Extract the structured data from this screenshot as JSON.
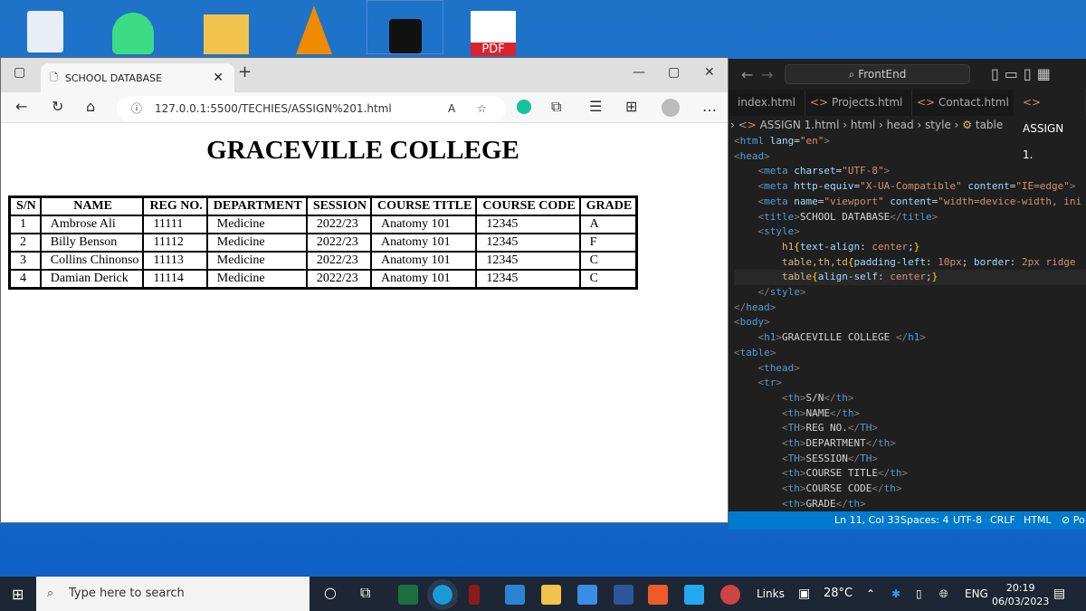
{
  "desktop": {
    "icons": [
      "recycle-bin",
      "android-studio",
      "folder",
      "vlc",
      "app",
      "pdf"
    ],
    "pdf_label": "PDF"
  },
  "browser": {
    "tab_title": "SCHOOL DATABASE",
    "url": "127.0.0.1:5500/TECHIES/ASSIGN%201.html",
    "page": {
      "heading": "GRACEVILLE COLLEGE",
      "columns": [
        "S/N",
        "NAME",
        "REG NO.",
        "DEPARTMENT",
        "SESSION",
        "COURSE TITLE",
        "COURSE CODE",
        "GRADE"
      ],
      "rows": [
        [
          "1",
          "Ambrose Ali",
          "11111",
          "Medicine",
          "2022/23",
          "Anatomy 101",
          "12345",
          "A"
        ],
        [
          "2",
          "Billy Benson",
          "11112",
          "Medicine",
          "2022/23",
          "Anatomy 101",
          "12345",
          "F"
        ],
        [
          "3",
          "Collins Chinonso",
          "11113",
          "Medicine",
          "2022/23",
          "Anatomy 101",
          "12345",
          "C"
        ],
        [
          "4",
          "Damian Derick",
          "11114",
          "Medicine",
          "2022/23",
          "Anatomy 101",
          "12345",
          "C"
        ]
      ]
    }
  },
  "editor": {
    "search": "FrontEnd",
    "tabs": [
      "index.html",
      "Projects.html",
      "Contact.html",
      "ASSIGN 1."
    ],
    "breadcrumb": [
      "ASSIGN 1.html",
      "html",
      "head",
      "style",
      "table"
    ],
    "code": [
      [
        [
          "br",
          "<"
        ],
        [
          "tag",
          "html "
        ],
        [
          "attr",
          "lang"
        ],
        [
          "txt",
          "="
        ],
        [
          "str",
          "\"en\""
        ],
        [
          "br",
          ">"
        ]
      ],
      [
        [
          "br",
          "<"
        ],
        [
          "tag",
          "head"
        ],
        [
          "br",
          ">"
        ]
      ],
      [
        [
          "txt",
          "    "
        ],
        [
          "br",
          "<"
        ],
        [
          "tag",
          "meta "
        ],
        [
          "attr",
          "charset"
        ],
        [
          "txt",
          "="
        ],
        [
          "str",
          "\"UTF-8\""
        ],
        [
          "br",
          ">"
        ]
      ],
      [
        [
          "txt",
          "    "
        ],
        [
          "br",
          "<"
        ],
        [
          "tag",
          "meta "
        ],
        [
          "attr",
          "http-equiv"
        ],
        [
          "txt",
          "="
        ],
        [
          "str",
          "\"X-UA-Compatible\" "
        ],
        [
          "attr",
          "content"
        ],
        [
          "txt",
          "="
        ],
        [
          "str",
          "\"IE=edge\""
        ],
        [
          "br",
          ">"
        ]
      ],
      [
        [
          "txt",
          "    "
        ],
        [
          "br",
          "<"
        ],
        [
          "tag",
          "meta "
        ],
        [
          "attr",
          "name"
        ],
        [
          "txt",
          "="
        ],
        [
          "str",
          "\"viewport\" "
        ],
        [
          "attr",
          "content"
        ],
        [
          "txt",
          "="
        ],
        [
          "str",
          "\"width=device-width, ini"
        ]
      ],
      [
        [
          "txt",
          "    "
        ],
        [
          "br",
          "<"
        ],
        [
          "tag",
          "title"
        ],
        [
          "br",
          ">"
        ],
        [
          "txt",
          "SCHOOL DATABASE"
        ],
        [
          "br",
          "</"
        ],
        [
          "tag",
          "title"
        ],
        [
          "br",
          ">"
        ]
      ],
      [
        [
          "txt",
          "    "
        ],
        [
          "br",
          "<"
        ],
        [
          "tag",
          "style"
        ],
        [
          "br",
          ">"
        ]
      ],
      [
        [
          "txt",
          "        "
        ],
        [
          "sel",
          "h1"
        ],
        [
          "punc",
          "{"
        ],
        [
          "attr",
          "text-align"
        ],
        [
          "txt",
          ": "
        ],
        [
          "str",
          "center"
        ],
        [
          "txt",
          ";"
        ],
        [
          "punc",
          "}"
        ]
      ],
      [
        [
          "txt",
          "        "
        ],
        [
          "sel",
          "table,th,td"
        ],
        [
          "punc",
          "{"
        ],
        [
          "attr",
          "padding-left"
        ],
        [
          "txt",
          ": "
        ],
        [
          "str",
          "10px"
        ],
        [
          "txt",
          "; "
        ],
        [
          "attr",
          "border"
        ],
        [
          "txt",
          ": "
        ],
        [
          "str",
          "2px ridge"
        ]
      ],
      [
        [
          "txt",
          "        "
        ],
        [
          "sel",
          "table"
        ],
        [
          "punc",
          "{"
        ],
        [
          "attr",
          "align-self"
        ],
        [
          "txt",
          ": "
        ],
        [
          "str",
          "center"
        ],
        [
          "txt",
          ";"
        ],
        [
          "punc",
          "}"
        ]
      ],
      [
        [
          "txt",
          "    "
        ],
        [
          "br",
          "</"
        ],
        [
          "tag",
          "style"
        ],
        [
          "br",
          ">"
        ]
      ],
      [
        [
          "br",
          "</"
        ],
        [
          "tag",
          "head"
        ],
        [
          "br",
          ">"
        ]
      ],
      [
        [
          "br",
          "<"
        ],
        [
          "tag",
          "body"
        ],
        [
          "br",
          ">"
        ]
      ],
      [
        [
          "txt",
          "    "
        ],
        [
          "br",
          "<"
        ],
        [
          "tag",
          "h1"
        ],
        [
          "br",
          ">"
        ],
        [
          "txt",
          "GRACEVILLE COLLEGE "
        ],
        [
          "br",
          "</"
        ],
        [
          "tag",
          "h1"
        ],
        [
          "br",
          ">"
        ]
      ],
      [
        [
          "br",
          "<"
        ],
        [
          "tag",
          "table"
        ],
        [
          "br",
          ">"
        ]
      ],
      [
        [
          "txt",
          "    "
        ],
        [
          "br",
          "<"
        ],
        [
          "tag",
          "thead"
        ],
        [
          "br",
          ">"
        ]
      ],
      [
        [
          "txt",
          "    "
        ],
        [
          "br",
          "<"
        ],
        [
          "tag",
          "tr"
        ],
        [
          "br",
          ">"
        ]
      ],
      [
        [
          "txt",
          "        "
        ],
        [
          "br",
          "<"
        ],
        [
          "tag",
          "th"
        ],
        [
          "br",
          ">"
        ],
        [
          "txt",
          "S/N"
        ],
        [
          "br",
          "</"
        ],
        [
          "tag",
          "th"
        ],
        [
          "br",
          ">"
        ]
      ],
      [
        [
          "txt",
          "        "
        ],
        [
          "br",
          "<"
        ],
        [
          "tag",
          "th"
        ],
        [
          "br",
          ">"
        ],
        [
          "txt",
          "NAME"
        ],
        [
          "br",
          "</"
        ],
        [
          "tag",
          "th"
        ],
        [
          "br",
          ">"
        ]
      ],
      [
        [
          "txt",
          "        "
        ],
        [
          "br",
          "<"
        ],
        [
          "tag",
          "TH"
        ],
        [
          "br",
          ">"
        ],
        [
          "txt",
          "REG NO."
        ],
        [
          "br",
          "</"
        ],
        [
          "tag",
          "TH"
        ],
        [
          "br",
          ">"
        ]
      ],
      [
        [
          "txt",
          "        "
        ],
        [
          "br",
          "<"
        ],
        [
          "tag",
          "th"
        ],
        [
          "br",
          ">"
        ],
        [
          "txt",
          "DEPARTMENT"
        ],
        [
          "br",
          "</"
        ],
        [
          "tag",
          "th"
        ],
        [
          "br",
          ">"
        ]
      ],
      [
        [
          "txt",
          "        "
        ],
        [
          "br",
          "<"
        ],
        [
          "tag",
          "TH"
        ],
        [
          "br",
          ">"
        ],
        [
          "txt",
          "SESSION"
        ],
        [
          "br",
          "</"
        ],
        [
          "tag",
          "TH"
        ],
        [
          "br",
          ">"
        ]
      ],
      [
        [
          "txt",
          "        "
        ],
        [
          "br",
          "<"
        ],
        [
          "tag",
          "th"
        ],
        [
          "br",
          ">"
        ],
        [
          "txt",
          "COURSE TITLE"
        ],
        [
          "br",
          "</"
        ],
        [
          "tag",
          "th"
        ],
        [
          "br",
          ">"
        ]
      ],
      [
        [
          "txt",
          "        "
        ],
        [
          "br",
          "<"
        ],
        [
          "tag",
          "th"
        ],
        [
          "br",
          ">"
        ],
        [
          "txt",
          "COURSE CODE"
        ],
        [
          "br",
          "</"
        ],
        [
          "tag",
          "th"
        ],
        [
          "br",
          ">"
        ]
      ],
      [
        [
          "txt",
          "        "
        ],
        [
          "br",
          "<"
        ],
        [
          "tag",
          "th"
        ],
        [
          "br",
          ">"
        ],
        [
          "txt",
          "GRADE"
        ],
        [
          "br",
          "</"
        ],
        [
          "tag",
          "th"
        ],
        [
          "br",
          ">"
        ]
      ]
    ],
    "status": {
      "position": "Ln 11, Col 33",
      "spaces": "Spaces: 4",
      "encoding": "UTF-8",
      "eol": "CRLF",
      "language": "HTML",
      "extra": "⊘ Po"
    }
  },
  "taskbar": {
    "search_placeholder": "Type here to search",
    "links": "Links",
    "weather": "28°C",
    "language": "ENG",
    "time": "20:19",
    "date": "06/03/2023"
  }
}
